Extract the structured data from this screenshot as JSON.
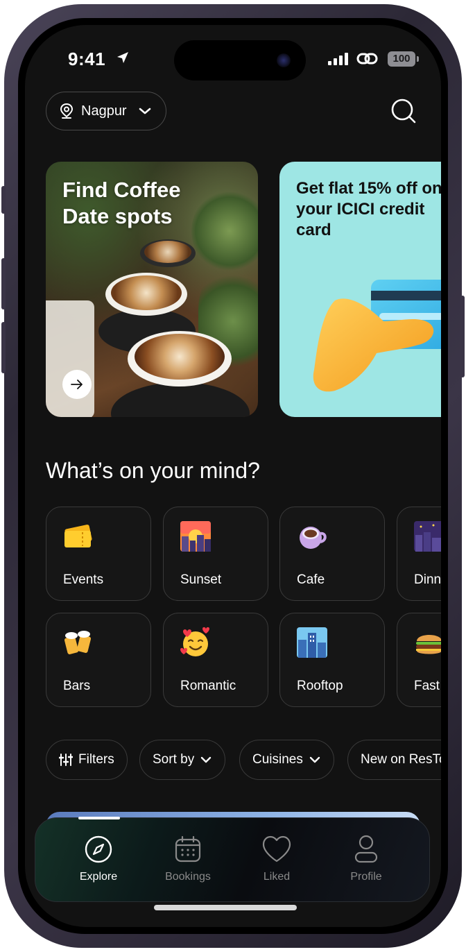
{
  "status_bar": {
    "time": "9:41",
    "battery": "100"
  },
  "location": {
    "city": "Nagpur"
  },
  "banners": [
    {
      "title_line1": "Find Coffee",
      "title_line2": "Date spots"
    },
    {
      "title": "Get flat 15% off on your ICICI credit card"
    }
  ],
  "section_title": "What’s on your mind?",
  "categories_row1": [
    {
      "label": "Events",
      "icon": "ticket-icon"
    },
    {
      "label": "Sunset",
      "icon": "sunset-icon"
    },
    {
      "label": "Cafe",
      "icon": "coffee-cup-icon"
    },
    {
      "label": "Dinner",
      "icon": "night-city-icon"
    }
  ],
  "categories_row2": [
    {
      "label": "Bars",
      "icon": "beer-mugs-icon"
    },
    {
      "label": "Romantic",
      "icon": "smiling-hearts-icon"
    },
    {
      "label": "Rooftop",
      "icon": "cityscape-icon"
    },
    {
      "label": "Fast",
      "icon": "burger-icon"
    }
  ],
  "filters": {
    "filters_label": "Filters",
    "sort_label": "Sort by",
    "cuisines_label": "Cuisines",
    "new_label": "New on ResTo"
  },
  "tabs": [
    {
      "label": "Explore",
      "icon": "compass-icon",
      "active": true
    },
    {
      "label": "Bookings",
      "icon": "calendar-icon"
    },
    {
      "label": "Liked",
      "icon": "heart-icon"
    },
    {
      "label": "Profile",
      "icon": "user-icon"
    }
  ],
  "colors": {
    "background": "#121212",
    "banner_teal": "#9ee6e4",
    "card_border": "#3a3a3a",
    "inactive_tab": "#8a8a8a"
  }
}
